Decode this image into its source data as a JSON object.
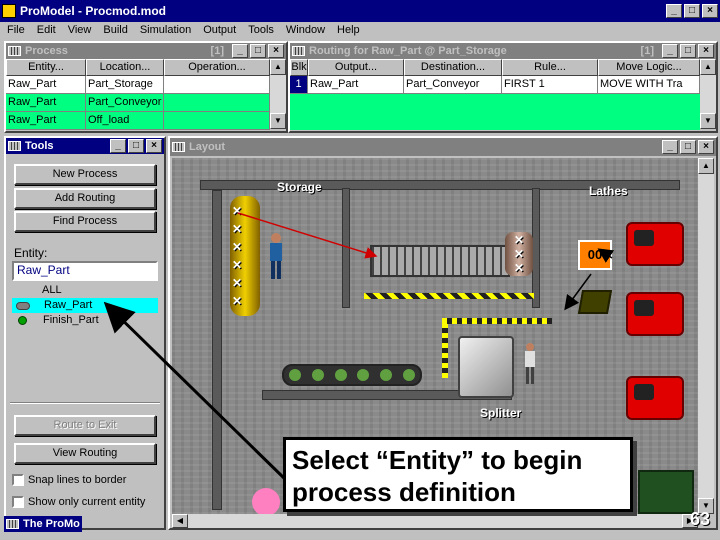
{
  "app": {
    "title": "ProModel - Procmod.mod",
    "menu": [
      "File",
      "Edit",
      "View",
      "Build",
      "Simulation",
      "Output",
      "Tools",
      "Window",
      "Help"
    ]
  },
  "process": {
    "title": "Process",
    "counter": "[1]",
    "columns": [
      "Entity...",
      "Location...",
      "Operation..."
    ],
    "rows": [
      {
        "entity": "Raw_Part",
        "location": "Part_Storage",
        "operation": ""
      },
      {
        "entity": "Raw_Part",
        "location": "Part_Conveyor",
        "operation": ""
      },
      {
        "entity": "Raw_Part",
        "location": "Off_load",
        "operation": ""
      }
    ]
  },
  "routing": {
    "title": "Routing for Raw_Part @ Part_Storage",
    "counter": "[1]",
    "columns": [
      "Blk",
      "Output...",
      "Destination...",
      "Rule...",
      "Move Logic..."
    ],
    "rows": [
      {
        "blk": "1",
        "output": "Raw_Part",
        "destination": "Part_Conveyor",
        "rule": "FIRST 1",
        "move": "MOVE WITH Tra"
      }
    ]
  },
  "tools": {
    "title": "Tools",
    "buttons": {
      "new_process": "New Process",
      "add_routing": "Add Routing",
      "find_process": "Find Process",
      "route_to_exit": "Route to Exit",
      "view_routing": "View Routing"
    },
    "entity_label": "Entity:",
    "entity_value": "Raw_Part",
    "entity_list": [
      "ALL",
      "Raw_Part",
      "Finish_Part"
    ],
    "options": [
      "Snap lines to border",
      "Show only current entity"
    ]
  },
  "layout": {
    "title": "Layout",
    "labels": {
      "storage": "Storage",
      "lathes": "Lathes",
      "splitter": "Splitter",
      "counter": "00"
    }
  },
  "callout": {
    "text": "Select “Entity” to begin process definition"
  },
  "taskbar": {
    "item": "The ProMo"
  },
  "slide_number": "63"
}
